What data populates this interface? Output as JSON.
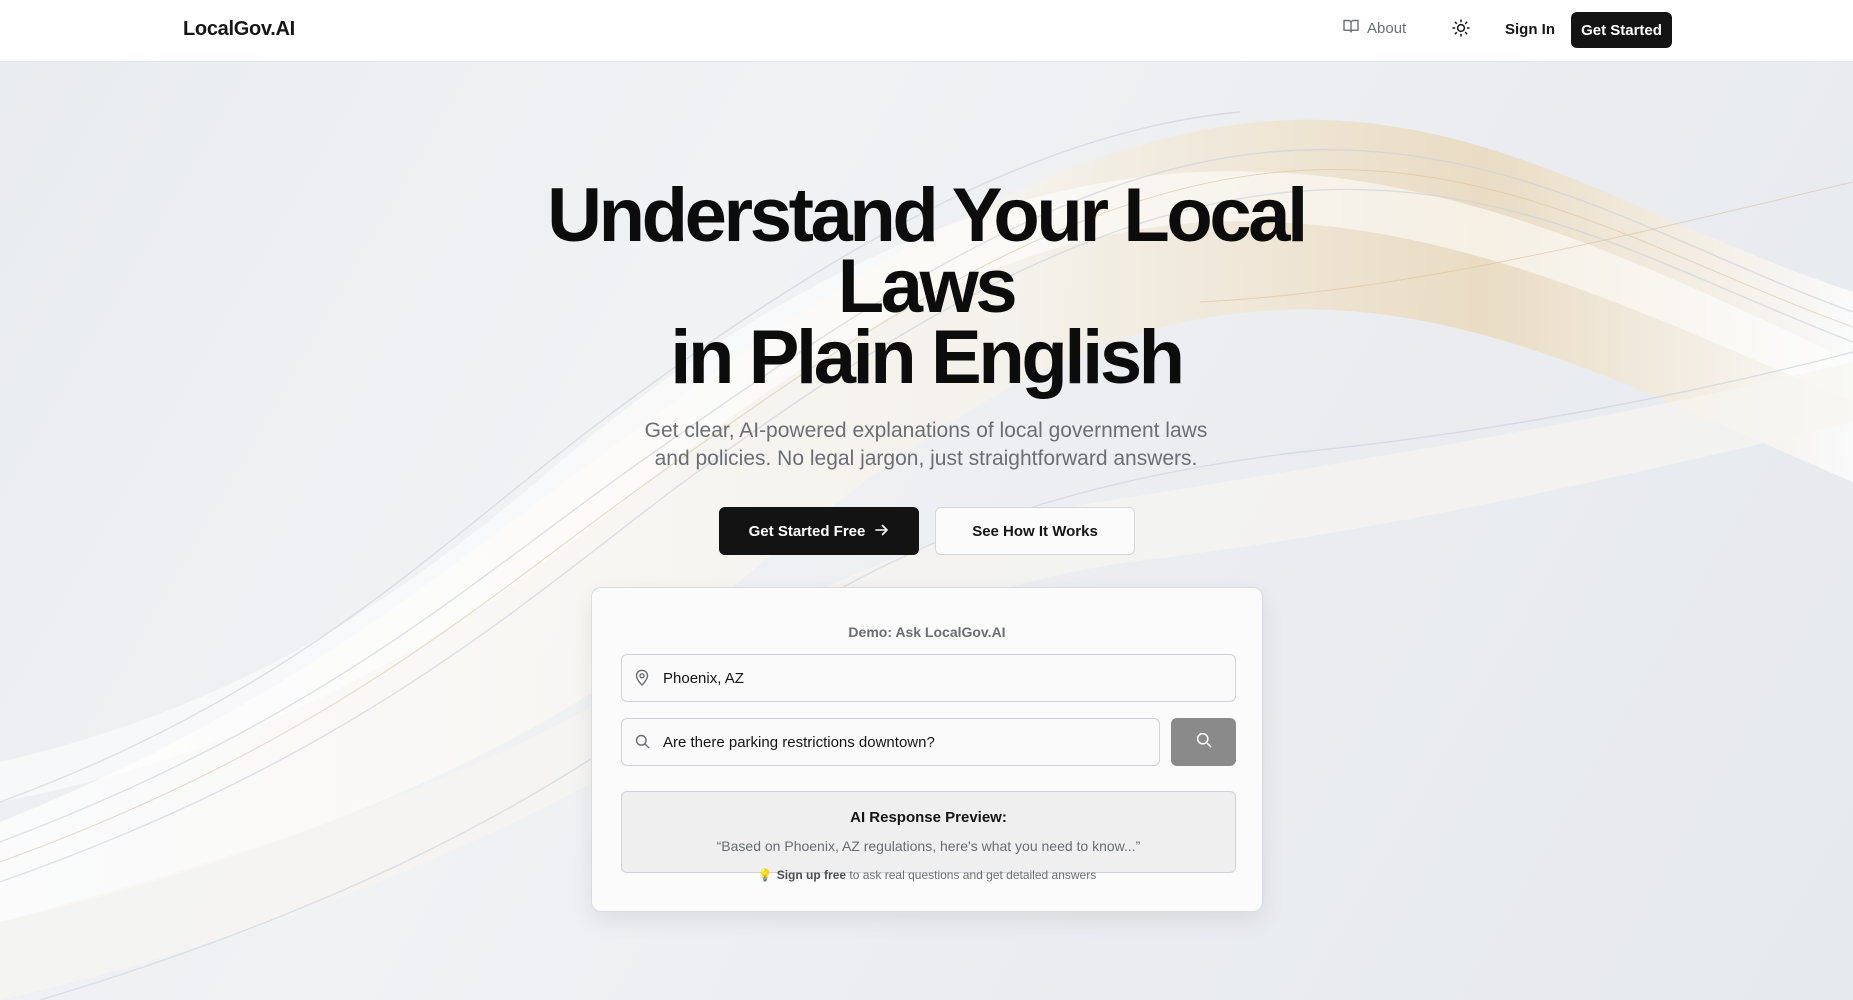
{
  "nav": {
    "logo": "LocalGov.AI",
    "about_label": "About",
    "sign_in_label": "Sign In",
    "get_started_label": "Get Started",
    "about_icon": "book-icon",
    "theme_icon": "sun-icon"
  },
  "hero": {
    "headline_line1": "Understand Your Local",
    "headline_line2": "Laws",
    "headline_line3": "in Plain English",
    "subtext_line1": "Get clear, AI-powered explanations of local government laws",
    "subtext_line2": "and policies. No legal jargon, just straightforward answers.",
    "primary_button": "Get Started Free",
    "secondary_button": "See How It Works"
  },
  "demo": {
    "title": "Demo: Ask LocalGov.AI",
    "location_value": "Phoenix, AZ",
    "query_value": "Are there parking restrictions downtown?",
    "preview_title": "AI Response Preview:",
    "preview_text": "“Based on Phoenix, AZ regulations, here's what you need to know...”",
    "signup_strong": "Sign up free",
    "signup_rest": " to ask real questions and get detailed answers"
  },
  "colors": {
    "primary": "#131313",
    "muted_text": "#6b6e74",
    "search_button": "#8a8a8a"
  }
}
